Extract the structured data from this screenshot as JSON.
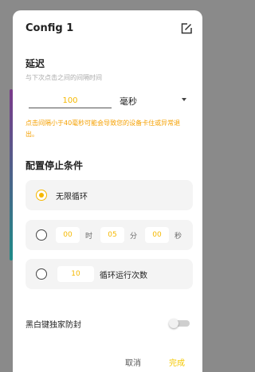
{
  "dialog": {
    "title": "Config 1",
    "edit_icon": "edit-icon"
  },
  "delay": {
    "title": "延迟",
    "subtitle": "与下次点击之间的间隔时间",
    "value": "100",
    "unit": "毫秒",
    "warning": "点击间隔小于40毫秒可能会导致您的设备卡住或异常退出。"
  },
  "stop": {
    "title": "配置停止条件",
    "options": [
      {
        "label": "无限循环",
        "selected": true
      },
      {
        "selected": false,
        "hours": "00",
        "hours_unit": "时",
        "minutes": "05",
        "minutes_unit": "分",
        "seconds": "00",
        "seconds_unit": "秒"
      },
      {
        "selected": false,
        "count": "10",
        "label": "循环运行次数"
      }
    ]
  },
  "toggle": {
    "label": "黑白键独家防封",
    "on": false
  },
  "buttons": {
    "cancel": "取消",
    "done": "完成"
  },
  "colors": {
    "accent": "#f5b800",
    "warning": "#f5a000"
  }
}
